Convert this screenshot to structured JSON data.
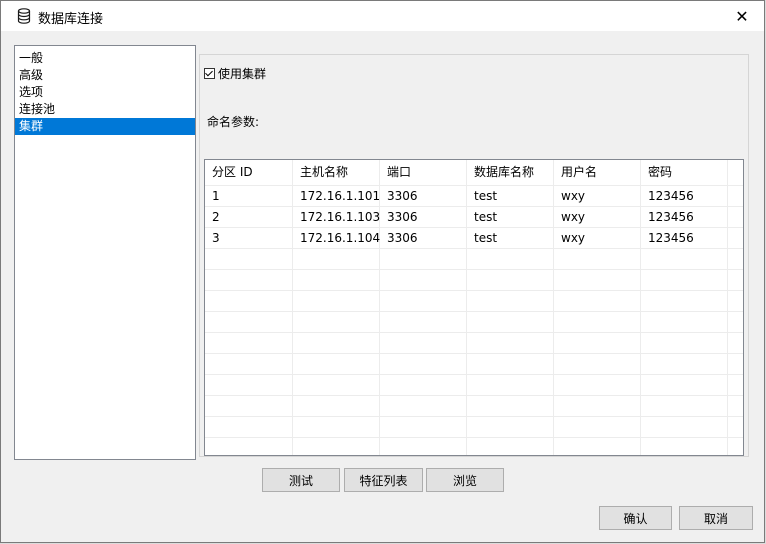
{
  "window": {
    "title": "数据库连接",
    "close_glyph": "✕"
  },
  "nav": {
    "items": [
      "一般",
      "高级",
      "选项",
      "连接池",
      "集群"
    ],
    "selected_index": 4
  },
  "cluster": {
    "checkbox_label": "使用集群",
    "checked": true,
    "param_label": "命名参数:"
  },
  "table": {
    "columns": [
      "分区 ID",
      "主机名称",
      "端口",
      "数据库名称",
      "用户名",
      "密码"
    ],
    "rows": [
      [
        "1",
        "172.16.1.101",
        "3306",
        "test",
        "wxy",
        "123456"
      ],
      [
        "2",
        "172.16.1.103",
        "3306",
        "test",
        "wxy",
        "123456"
      ],
      [
        "3",
        "172.16.1.104",
        "3306",
        "test",
        "wxy",
        "123456"
      ]
    ]
  },
  "buttons": {
    "test": "测试",
    "features": "特征列表",
    "browse": "浏览",
    "ok": "确认",
    "cancel": "取消"
  },
  "colors": {
    "selection": "#0078d7"
  }
}
